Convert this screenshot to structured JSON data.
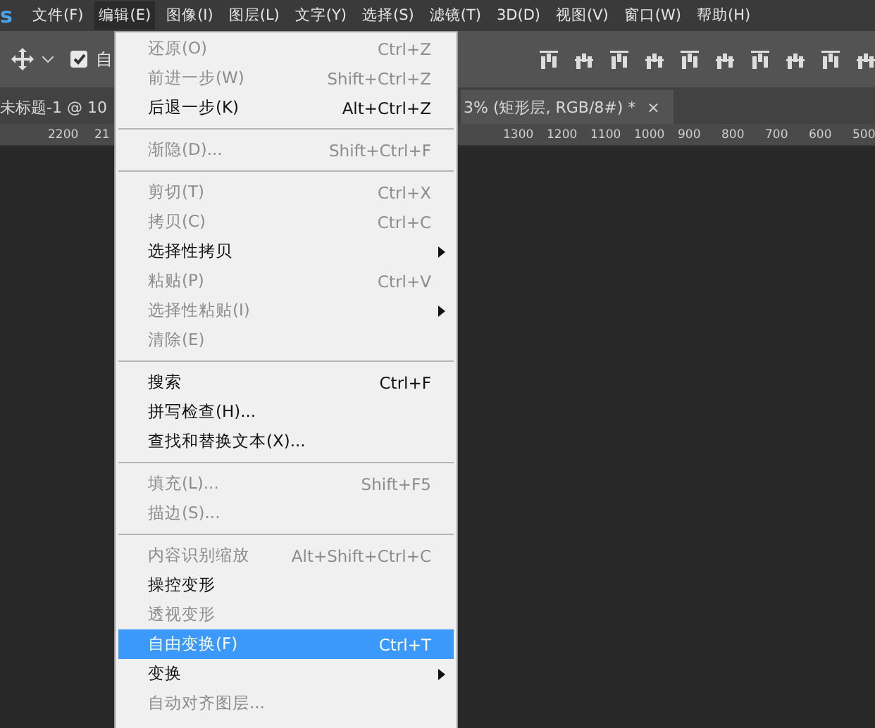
{
  "app_logo": "s",
  "menu_bar": [
    {
      "label": "文件(F)",
      "selected": false
    },
    {
      "label": "编辑(E)",
      "selected": true
    },
    {
      "label": "图像(I)",
      "selected": false
    },
    {
      "label": "图层(L)",
      "selected": false
    },
    {
      "label": "文字(Y)",
      "selected": false
    },
    {
      "label": "选择(S)",
      "selected": false
    },
    {
      "label": "滤镜(T)",
      "selected": false
    },
    {
      "label": "3D(D)",
      "selected": false
    },
    {
      "label": "视图(V)",
      "selected": false
    },
    {
      "label": "窗口(W)",
      "selected": false
    },
    {
      "label": "帮助(H)",
      "selected": false
    }
  ],
  "options_bar": {
    "auto_select": {
      "label": "自",
      "checked": true
    }
  },
  "document_tabs": [
    {
      "title": "未标题-1 @ 10",
      "selected": false
    },
    {
      "title": "3% (矩形层, RGB/8#) *",
      "selected": true,
      "close": "×"
    }
  ],
  "ruler": {
    "left_labels": [
      "2200",
      "21"
    ],
    "right_labels": [
      "1300",
      "1200",
      "1100",
      "1000",
      "900",
      "800",
      "700",
      "600",
      "500"
    ]
  },
  "edit_menu": [
    {
      "kind": "item",
      "label": "还原(O)",
      "shortcut": "Ctrl+Z",
      "disabled": true,
      "submenu": false,
      "selected": false
    },
    {
      "kind": "item",
      "label": "前进一步(W)",
      "shortcut": "Shift+Ctrl+Z",
      "disabled": true,
      "submenu": false,
      "selected": false
    },
    {
      "kind": "item",
      "label": "后退一步(K)",
      "shortcut": "Alt+Ctrl+Z",
      "disabled": false,
      "submenu": false,
      "selected": false
    },
    {
      "kind": "separator"
    },
    {
      "kind": "item",
      "label": "渐隐(D)...",
      "shortcut": "Shift+Ctrl+F",
      "disabled": true,
      "submenu": false,
      "selected": false
    },
    {
      "kind": "separator"
    },
    {
      "kind": "item",
      "label": "剪切(T)",
      "shortcut": "Ctrl+X",
      "disabled": true,
      "submenu": false,
      "selected": false
    },
    {
      "kind": "item",
      "label": "拷贝(C)",
      "shortcut": "Ctrl+C",
      "disabled": true,
      "submenu": false,
      "selected": false
    },
    {
      "kind": "item",
      "label": "选择性拷贝",
      "disabled": false,
      "submenu": true,
      "selected": false
    },
    {
      "kind": "item",
      "label": "粘贴(P)",
      "shortcut": "Ctrl+V",
      "disabled": true,
      "submenu": false,
      "selected": false
    },
    {
      "kind": "item",
      "label": "选择性粘贴(I)",
      "disabled": true,
      "submenu": true,
      "selected": false
    },
    {
      "kind": "item",
      "label": "清除(E)",
      "disabled": true,
      "submenu": false,
      "selected": false
    },
    {
      "kind": "separator"
    },
    {
      "kind": "item",
      "label": "搜索",
      "shortcut": "Ctrl+F",
      "disabled": false,
      "submenu": false,
      "selected": false
    },
    {
      "kind": "item",
      "label": "拼写检查(H)...",
      "disabled": false,
      "submenu": false,
      "selected": false
    },
    {
      "kind": "item",
      "label": "查找和替换文本(X)...",
      "disabled": false,
      "submenu": false,
      "selected": false
    },
    {
      "kind": "separator"
    },
    {
      "kind": "item",
      "label": "填充(L)...",
      "shortcut": "Shift+F5",
      "disabled": true,
      "submenu": false,
      "selected": false
    },
    {
      "kind": "item",
      "label": "描边(S)...",
      "disabled": true,
      "submenu": false,
      "selected": false
    },
    {
      "kind": "separator"
    },
    {
      "kind": "item",
      "label": "内容识别缩放",
      "shortcut": "Alt+Shift+Ctrl+C",
      "disabled": true,
      "submenu": false,
      "selected": false
    },
    {
      "kind": "item",
      "label": "操控变形",
      "disabled": false,
      "submenu": false,
      "selected": false
    },
    {
      "kind": "item",
      "label": "透视变形",
      "disabled": true,
      "submenu": false,
      "selected": false
    },
    {
      "kind": "item",
      "label": "自由变换(F)",
      "shortcut": "Ctrl+T",
      "disabled": false,
      "submenu": false,
      "selected": true
    },
    {
      "kind": "item",
      "label": "变换",
      "disabled": false,
      "submenu": true,
      "selected": false
    },
    {
      "kind": "item",
      "label": "自动对齐图层...",
      "disabled": true,
      "submenu": false,
      "selected": false
    }
  ]
}
